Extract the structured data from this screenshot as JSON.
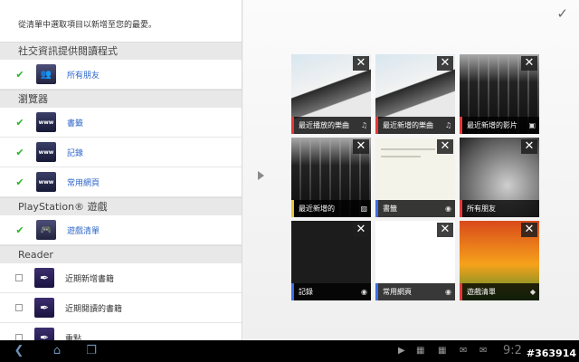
{
  "instruction": "從清單中選取項目以新增至您的最愛。",
  "left_panel": {
    "sections": [
      {
        "title": "社交資訊提供閱讀程式",
        "items": [
          {
            "label": "所有朋友",
            "checked": true,
            "icon": "friends-icon"
          }
        ]
      },
      {
        "title": "瀏覽器",
        "items": [
          {
            "label": "書籤",
            "checked": true,
            "icon": "www-icon"
          },
          {
            "label": "記錄",
            "checked": true,
            "icon": "www-icon"
          },
          {
            "label": "常用網頁",
            "checked": true,
            "icon": "www-icon"
          }
        ]
      },
      {
        "title": "PlayStation® 遊戲",
        "items": [
          {
            "label": "遊戲清單",
            "checked": true,
            "icon": "gamepad-icon"
          }
        ]
      },
      {
        "title": "Reader",
        "items": [
          {
            "label": "近期新增書籍",
            "checked": false,
            "icon": "reader-icon"
          },
          {
            "label": "近期閱讀的書籍",
            "checked": false,
            "icon": "reader-icon"
          },
          {
            "label": "重點",
            "checked": false,
            "icon": "reader-icon"
          }
        ]
      }
    ]
  },
  "favorites": [
    {
      "label": "最近播放的樂曲",
      "accent": "#e63737",
      "icon": "music-note-icon"
    },
    {
      "label": "最近新增的樂曲",
      "accent": "#e63737",
      "icon": "music-note-icon"
    },
    {
      "label": "最近新增的影片",
      "accent": "#e63737",
      "icon": "video-icon"
    },
    {
      "label": "最近新增的",
      "accent": "#e6c437",
      "icon": "gallery-icon"
    },
    {
      "label": "書籤",
      "accent": "#3a6ee6",
      "icon": "www-icon"
    },
    {
      "label": "所有朋友",
      "accent": "#e63737",
      "icon": "friends-icon"
    },
    {
      "label": "記錄",
      "accent": "#3a6ee6",
      "icon": "www-icon"
    },
    {
      "label": "常用網頁",
      "accent": "#3a6ee6",
      "icon": "www-icon"
    },
    {
      "label": "遊戲清單",
      "accent": "#e63737",
      "icon": "gamepad-icon"
    }
  ],
  "watermark": "#363914",
  "statusbar": {
    "time": "9:2"
  }
}
